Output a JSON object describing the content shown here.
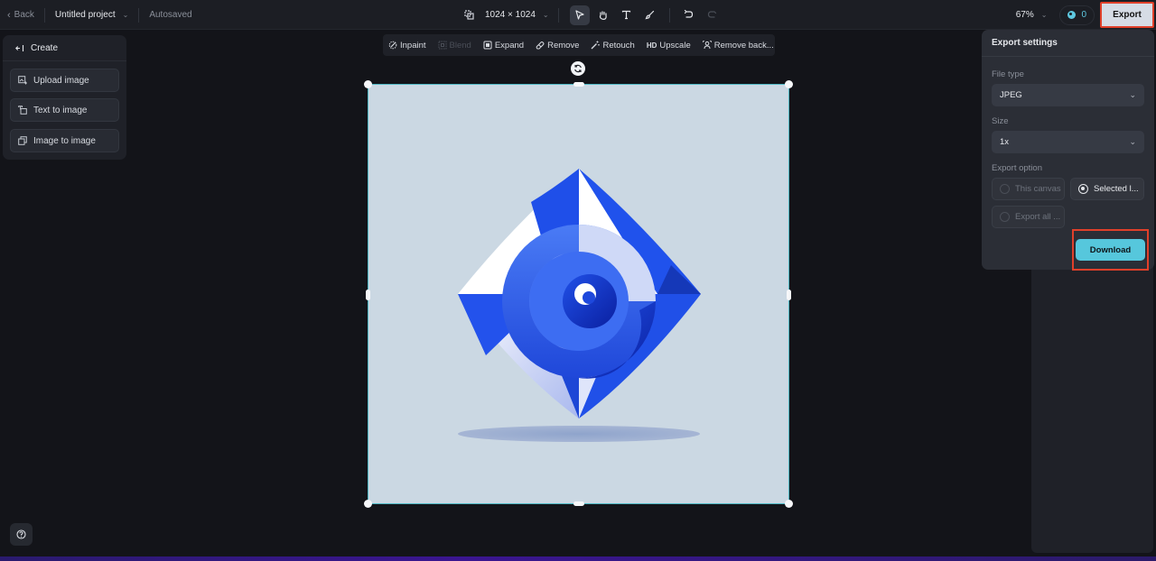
{
  "topbar": {
    "back_label": "Back",
    "project_name": "Untitled project",
    "autosave_status": "Autosaved",
    "canvas_size": "1024 × 1024",
    "tools": [
      {
        "name": "select",
        "icon": "cursor-arrow-icon",
        "active": true
      },
      {
        "name": "hand",
        "icon": "hand-icon",
        "active": false
      },
      {
        "name": "text",
        "icon": "text-icon",
        "active": false
      },
      {
        "name": "brush",
        "icon": "brush-icon",
        "active": false
      },
      {
        "name": "undo",
        "icon": "undo-icon",
        "active": false
      },
      {
        "name": "redo",
        "icon": "redo-icon",
        "disabled": true
      }
    ],
    "zoom_level": "67%",
    "credits": "0",
    "export_label": "Export"
  },
  "create_panel": {
    "title": "Create",
    "items": [
      {
        "label": "Upload image",
        "icon": "upload-image-icon"
      },
      {
        "label": "Text to image",
        "icon": "text-to-image-icon"
      },
      {
        "label": "Image to image",
        "icon": "image-to-image-icon"
      }
    ]
  },
  "edit_toolbar": {
    "items": [
      {
        "label": "Inpaint",
        "icon": "inpaint-icon",
        "disabled": false
      },
      {
        "label": "Blend",
        "icon": "blend-icon",
        "disabled": true
      },
      {
        "label": "Expand",
        "icon": "expand-icon",
        "disabled": false
      },
      {
        "label": "Remove",
        "icon": "eraser-icon",
        "disabled": false
      },
      {
        "label": "Retouch",
        "icon": "magic-wand-icon",
        "disabled": false
      },
      {
        "label": "Upscale",
        "icon": "hd-icon",
        "badge": "HD",
        "disabled": false
      },
      {
        "label": "Remove back...",
        "icon": "remove-background-icon",
        "disabled": false
      }
    ]
  },
  "canvas": {
    "background": "#cbd8e3",
    "selection_color": "#4fb8c4",
    "image_description": "Blue and white geometric diamond logo with spiral center"
  },
  "export_panel": {
    "title": "Export settings",
    "file_type_label": "File type",
    "file_type_value": "JPEG",
    "size_label": "Size",
    "size_value": "1x",
    "export_option_label": "Export option",
    "options": [
      {
        "label": "This canvas",
        "selected": false
      },
      {
        "label": "Selected l...",
        "selected": true
      },
      {
        "label": "Export all ...",
        "selected": false
      }
    ],
    "download_label": "Download"
  },
  "colors": {
    "accent": "#56c7dc",
    "highlight_border": "#e0402a"
  }
}
